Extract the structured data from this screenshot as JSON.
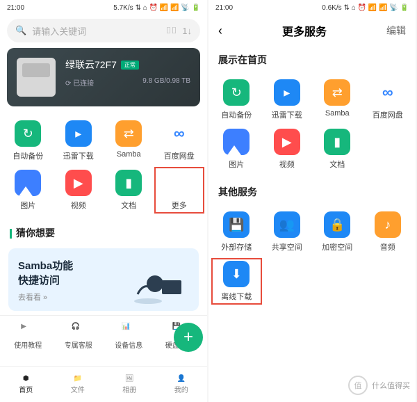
{
  "statusbar": {
    "time": "21:00",
    "net1": "5.7K/s",
    "net2": "0.6K/s"
  },
  "search": {
    "placeholder": "请输入关键词"
  },
  "device": {
    "name": "绿联云72F7",
    "badge": "正常",
    "status": "已连接",
    "storage": "9.8 GB/0.98 TB"
  },
  "gridA": [
    {
      "label": "自动备份"
    },
    {
      "label": "迅雷下载"
    },
    {
      "label": "Samba"
    },
    {
      "label": "百度网盘"
    },
    {
      "label": "图片"
    },
    {
      "label": "视频"
    },
    {
      "label": "文档"
    },
    {
      "label": "更多"
    }
  ],
  "guess": {
    "title": "猜你想要"
  },
  "promo": {
    "title": "Samba功能",
    "subtitle": "快捷访问",
    "link": "去看看 »"
  },
  "actions": [
    {
      "label": "使用教程"
    },
    {
      "label": "专属客服"
    },
    {
      "label": "设备信息"
    },
    {
      "label": "硬盘信息"
    }
  ],
  "tabs": [
    {
      "label": "首页"
    },
    {
      "label": "文件"
    },
    {
      "label": "相册"
    },
    {
      "label": "我的"
    }
  ],
  "screen2": {
    "title": "更多服务",
    "edit": "编辑",
    "sec1": "展示在首页",
    "grid1": [
      {
        "label": "自动备份"
      },
      {
        "label": "迅雷下载"
      },
      {
        "label": "Samba"
      },
      {
        "label": "百度网盘"
      },
      {
        "label": "图片"
      },
      {
        "label": "视频"
      },
      {
        "label": "文档"
      }
    ],
    "sec2": "其他服务",
    "grid2": [
      {
        "label": "外部存储"
      },
      {
        "label": "共享空间"
      },
      {
        "label": "加密空间"
      },
      {
        "label": "音频"
      },
      {
        "label": "离线下载"
      }
    ]
  },
  "watermark": "什么值得买"
}
